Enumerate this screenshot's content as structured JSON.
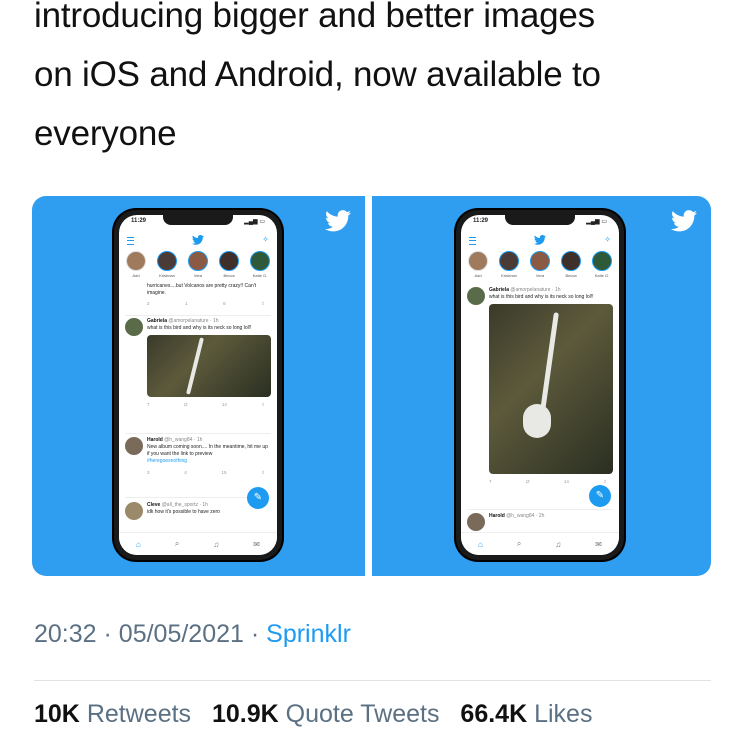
{
  "headline": {
    "lines": [
      "introducing bigger and better images",
      "on iOS and Android, now available to",
      "everyone"
    ]
  },
  "accent_color": "#1d9bf0",
  "panel_color": "#2f9df0",
  "screenshots": [
    {
      "time": "11:29",
      "fleets": [
        "Add",
        "Krishnan",
        "Vera",
        "Becca",
        "Katie G."
      ],
      "partial_tweet": "hurricanes....but Volcanos are pretty crazy!! Can't imagine.",
      "partial_actions": [
        "2",
        "1",
        "8",
        ""
      ],
      "tweet": {
        "name": "Gabriela",
        "handle": "@amorpelanature · 1h",
        "text": "what is this bird and why is its neck so long lol!!",
        "actions": [
          "7",
          "",
          "14",
          ""
        ]
      },
      "tweet2": {
        "name": "Harold",
        "handle": "@h_wang84 · 1h",
        "text": "New album coming soon.... In the meantime, hit me up if you want the link to preview",
        "hashtag": "#heregoesnothing",
        "actions": [
          "3",
          "4",
          "15",
          ""
        ]
      },
      "tweet3": {
        "name": "Cleve",
        "handle": "@all_the_sportz · 1h",
        "text": "idk how it's possible to have zero"
      }
    },
    {
      "time": "11:29",
      "fleets": [
        "Add",
        "Krishnan",
        "Vera",
        "Becca",
        "Katie G."
      ],
      "tweet": {
        "name": "Gabriela",
        "handle": "@amorpelanature · 1h",
        "text": "what is this bird and why is its neck so long lol!!",
        "actions": [
          "7",
          "",
          "14",
          ""
        ]
      },
      "tweet2": {
        "name": "Harold",
        "handle": "@h_wang84 · 2h"
      }
    }
  ],
  "meta": {
    "time": "20:32",
    "date": "05/05/2021",
    "separator": "·",
    "source": "Sprinklr"
  },
  "stats": {
    "retweets_count": "10K",
    "retweets_label": "Retweets",
    "quotes_count": "10.9K",
    "quotes_label": "Quote Tweets",
    "likes_count": "66.4K",
    "likes_label": "Likes"
  }
}
